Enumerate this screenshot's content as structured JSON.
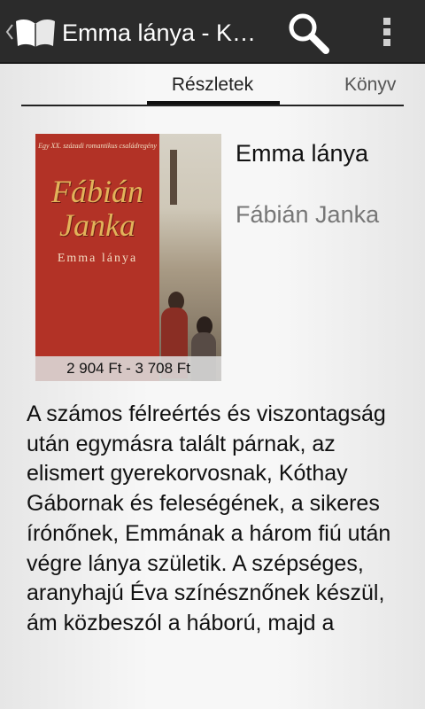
{
  "action_bar": {
    "title": "Emma lánya - K…",
    "app_icon": "open-book-icon",
    "search_icon": "search-icon",
    "overflow_icon": "overflow-menu-icon"
  },
  "tabs": {
    "items": [
      {
        "label": "Részletek",
        "selected": true
      },
      {
        "label": "Könyv",
        "selected": false
      }
    ]
  },
  "book": {
    "title": "Emma lánya",
    "author": "Fábián Janka",
    "price": "2 904 Ft - 3 708 Ft",
    "cover": {
      "tagline": "Egy XX. századi romantikus családregény",
      "author": "Fábián Janka",
      "title": "Emma lánya"
    },
    "description": "A számos félreértés és viszontagság után egymásra talált párnak, az elismert gyerekorvosnak, Kóthay Gábornak és feleségének, a sikeres írónőnek, Emmának a három fiú után végre lánya születik. A szépséges, aranyhajú Éva színésznőnek készül, ám közbeszól a háború, majd a"
  },
  "colors": {
    "action_bar": "#2b2b2b",
    "cover_red": "#b23226",
    "author_gray": "#777777"
  }
}
